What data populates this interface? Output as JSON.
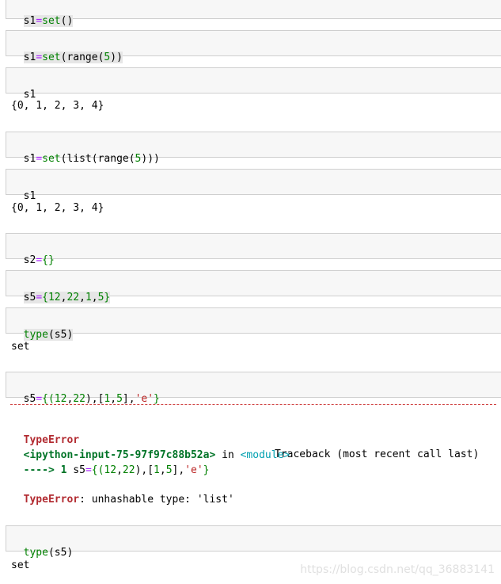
{
  "cells": [
    {
      "parts": [
        "s1",
        "=",
        "set",
        "()"
      ]
    },
    {
      "parts": [
        "s1",
        "=",
        "set",
        "(range(",
        "5",
        "))"
      ]
    },
    {
      "parts": [
        "s1"
      ],
      "output": "{0, 1, 2, 3, 4}"
    },
    {
      "parts": [
        "s1",
        "=",
        "set",
        "(list(range(",
        "5",
        ")))"
      ]
    },
    {
      "parts": [
        "s1"
      ],
      "output": "{0, 1, 2, 3, 4}"
    },
    {
      "parts": [
        "s2",
        "=",
        "{}"
      ]
    },
    {
      "parts": [
        "s5",
        "=",
        "{",
        "12",
        ",",
        "22",
        ",",
        "1",
        ",",
        "5",
        "}"
      ]
    },
    {
      "parts": [
        "type",
        "(s5)"
      ],
      "output": "set"
    },
    {
      "parts": [
        "s5",
        "=",
        "{(",
        "12",
        ",",
        "22",
        "),[",
        "1",
        ",",
        "5",
        "],",
        "'e'",
        "}"
      ]
    },
    {
      "parts": [
        "type",
        "(s5)"
      ],
      "output": "set"
    }
  ],
  "traceback": {
    "error_name": "TypeError",
    "traceback_label": "Traceback (most recent call last)",
    "location": "<ipython-input-75-97f97c88b52a>",
    "in_word": " in ",
    "module": "<module>",
    "arrow_line_prefix": "----> 1 ",
    "arrow_line_code": [
      "s5",
      "=",
      "{(",
      "12",
      ",",
      "22",
      "),[",
      "1",
      ",",
      "5",
      "],",
      "'e'",
      "}"
    ],
    "message_name": "TypeError",
    "message_text": ": unhashable type: 'list'"
  },
  "watermark": "https://blog.csdn.net/qq_36883141"
}
